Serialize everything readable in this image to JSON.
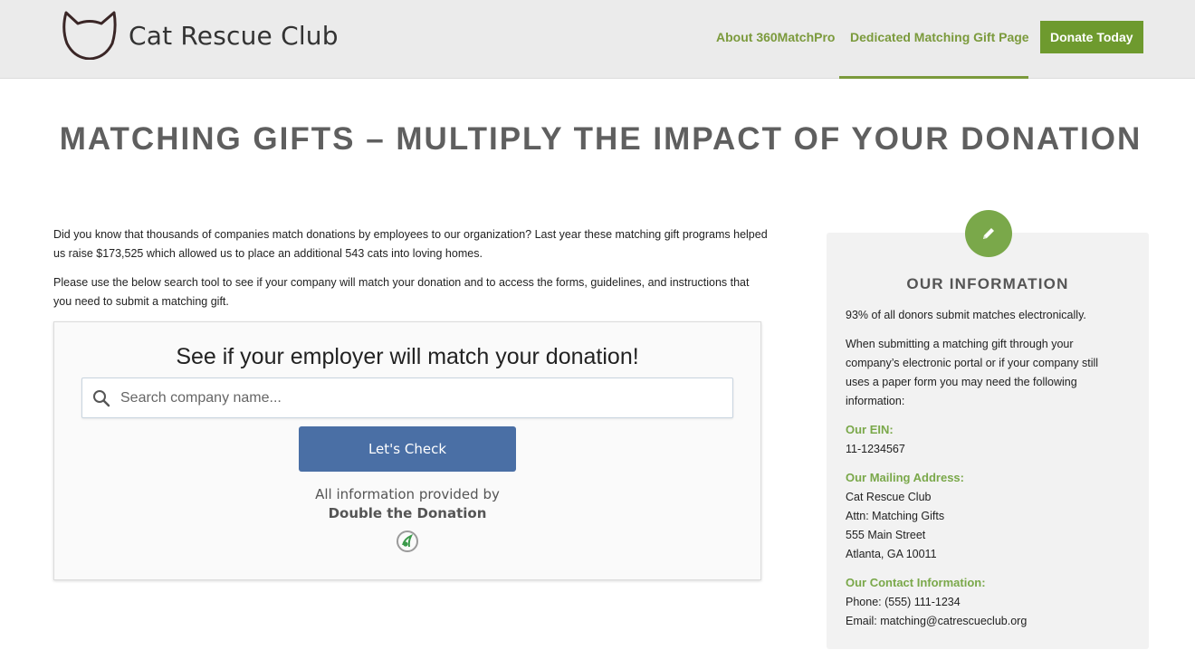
{
  "header": {
    "logo_text": "Cat Rescue Club",
    "nav": [
      {
        "label": "About 360MatchPro"
      },
      {
        "label": "Dedicated Matching Gift Page"
      }
    ],
    "donate_label": "Donate Today",
    "colors": {
      "accent": "#7b9a3c",
      "donate_bg": "#6e9a2e",
      "header_bg": "#ebebeb"
    }
  },
  "page": {
    "title": "MATCHING GIFTS – MULTIPLY THE IMPACT OF YOUR DONATION",
    "intro_1": "Did you know that thousands of companies match donations by employees to our organization? Last year these matching gift programs helped us raise $173,525 which allowed us to place an additional 543 cats into loving homes.",
    "intro_2": "Please use the below search tool to see if your company will match your donation and to access the forms, guidelines, and instructions that you need to submit a matching gift."
  },
  "widget": {
    "heading": "See if your employer will match your donation!",
    "search_placeholder": "Search company name...",
    "search_value": "",
    "button_label": "Let's Check",
    "provided_by": "All information provided by",
    "provider": "Double the Donation",
    "colors": {
      "button": "#4a6fa5"
    }
  },
  "sidebar": {
    "title": "OUR INFORMATION",
    "stat": "93% of all donors submit matches electronically.",
    "note": "When submitting a matching gift through your company’s electronic portal or if your company still uses a paper form you may need the following information:",
    "ein_label": "Our EIN:",
    "ein": "11-1234567",
    "address_label": "Our Mailing Address:",
    "address": [
      "Cat Rescue Club",
      "Attn: Matching Gifts",
      "555 Main Street",
      "Atlanta, GA 10011"
    ],
    "contact_label": "Our Contact Information:",
    "phone": "Phone: (555) 111-1234",
    "email": "Email: matching@catrescueclub.org",
    "badge_icon": "pencil-icon",
    "colors": {
      "label": "#7aa84a"
    }
  }
}
